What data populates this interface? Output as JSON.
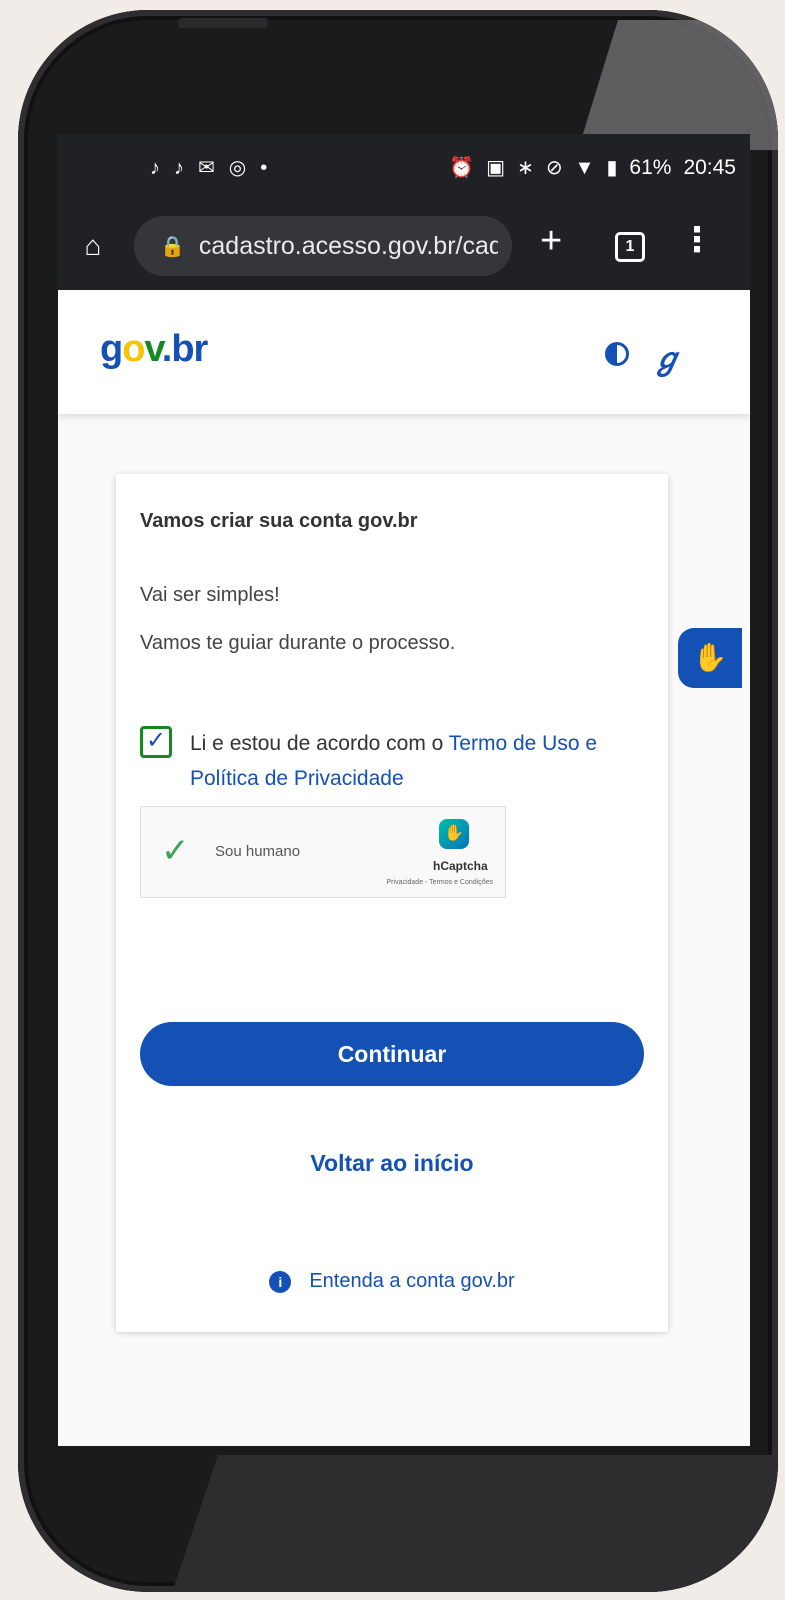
{
  "status_bar": {
    "left_icons": [
      "tiktok-icon",
      "tiktok-icon",
      "gmail-icon",
      "instagram-icon",
      "dot-icon"
    ],
    "right_icons": [
      "alarm-icon",
      "nfc-icon",
      "bluetooth-icon",
      "mute-icon",
      "wifi-icon",
      "signal-icon",
      "battery-icon"
    ],
    "battery": "61%",
    "time": "20:45"
  },
  "browser": {
    "url": "cadastro.acesso.gov.br/cadá",
    "tab_count": "1"
  },
  "header": {
    "logo_g": "g",
    "logo_o": "o",
    "logo_v": "v",
    "logo_dot": ".",
    "logo_br": "br"
  },
  "card": {
    "title": "Vamos criar sua conta gov.br",
    "subtitle1": "Vai ser simples!",
    "subtitle2": "Vamos te guiar durante o processo.",
    "consent_prefix": "Li e estou de acordo com o ",
    "consent_link": "Termo de Uso e Política de Privacidade",
    "checkbox_checked": true
  },
  "captcha": {
    "label": "Sou humano",
    "brand": "hCaptcha",
    "links": "Privacidade - Termos e Condições"
  },
  "actions": {
    "continue": "Continuar",
    "back": "Voltar ao início",
    "info": "Entenda a conta gov.br"
  },
  "colors": {
    "primary": "#1351b4",
    "success": "#168821",
    "browser_bar": "#202124"
  }
}
